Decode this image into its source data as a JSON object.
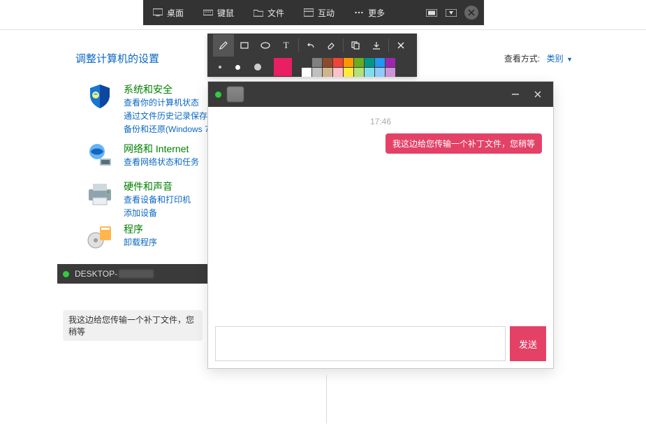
{
  "toolbar": {
    "items": [
      {
        "id": "desktop",
        "label": "桌面"
      },
      {
        "id": "keymouse",
        "label": "键鼠"
      },
      {
        "id": "file",
        "label": "文件"
      },
      {
        "id": "interact",
        "label": "互动"
      },
      {
        "id": "more",
        "label": "更多"
      }
    ]
  },
  "annotation": {
    "colors_big": "#e91e63",
    "swatches": [
      "#3a3a3a",
      "#808080",
      "#8e4a2b",
      "#f44336",
      "#ff9800",
      "#68ad1f",
      "#009688",
      "#2196f3",
      "#9c27b0",
      "#ffffff",
      "#c0c0c0",
      "#d2b48c",
      "#ffc0cb",
      "#ffeb3b",
      "#b6e07a",
      "#80deea",
      "#90caf9",
      "#ce93d8"
    ]
  },
  "control_panel": {
    "title": "调整计算机的设置",
    "view_by_label": "查看方式:",
    "view_by_value": "类别",
    "categories": [
      {
        "title": "系统和安全",
        "links": [
          "查看你的计算机状态",
          "通过文件历史记录保存你",
          "备份和还原(Windows 7"
        ]
      },
      {
        "title": "网络和 Internet",
        "links": [
          "查看网络状态和任务"
        ]
      },
      {
        "title": "硬件和声音",
        "links": [
          "查看设备和打印机",
          "添加设备"
        ]
      },
      {
        "title": "程序",
        "links": [
          "卸载程序"
        ]
      }
    ]
  },
  "bg_chat": {
    "title_prefix": "DESKTOP-",
    "bubble": "我这边给您传输一个补丁文件，您稍等"
  },
  "chat": {
    "timestamp": "17:46",
    "message": "我这边给您传输一个补丁文件，您稍等",
    "input_value": "",
    "send_label": "发送"
  }
}
